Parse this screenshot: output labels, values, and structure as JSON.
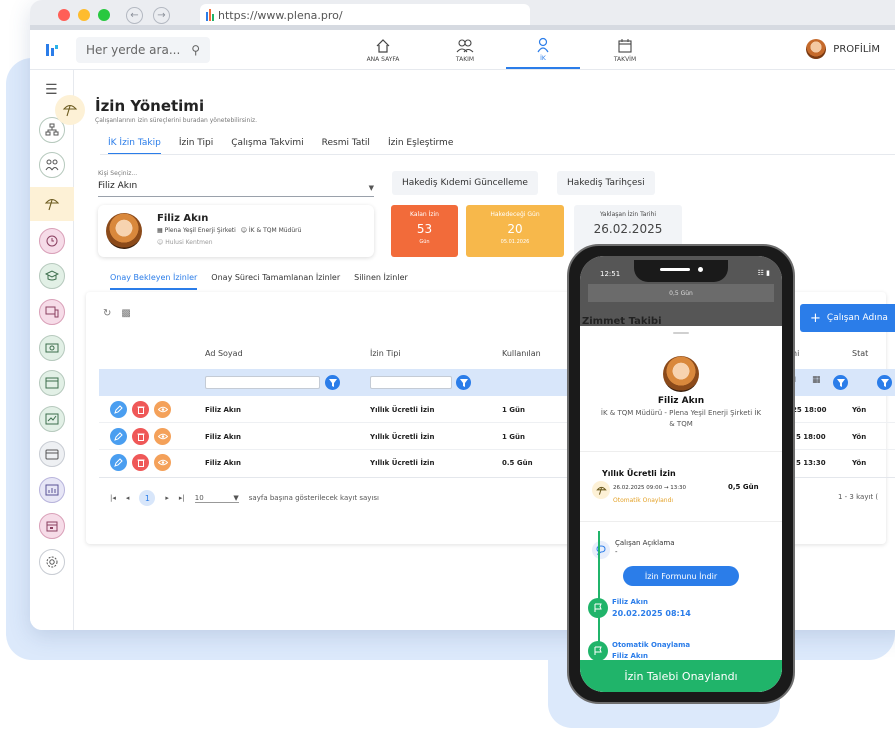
{
  "browser": {
    "url": "https://www.plena.pro/"
  },
  "appnav": {
    "search_placeholder": "Her yerde ara...",
    "items": [
      {
        "label": "ANA SAYFA",
        "icon": "home-icon"
      },
      {
        "label": "TAKIM",
        "icon": "team-icon"
      },
      {
        "label": "İK",
        "icon": "hr-icon",
        "active": true
      },
      {
        "label": "TAKVİM",
        "icon": "calendar-icon"
      }
    ],
    "profile_label": "PROFİLİM"
  },
  "page": {
    "title": "İzin Yönetimi",
    "subtitle": "Çalışanlarının izin süreçlerini buradan yönetebilirsiniz.",
    "tabs": [
      "İK İzin Takip",
      "İzin Tipi",
      "Çalışma Takvimi",
      "Resmi Tatil",
      "İzin Eşleştirme"
    ],
    "active_tab": "İK İzin Takip"
  },
  "person_select": {
    "label": "Kişi Seçiniz...",
    "value": "Filiz Akın"
  },
  "actions": {
    "update_button": "Hakediş Kıdemi Güncelleme",
    "history_button": "Hakediş Tarihçesi"
  },
  "person_card": {
    "name": "Filiz Akın",
    "company_role": "Plena Yeşil Enerji Şirketi",
    "department_role": "İK & TQM Müdürü",
    "manager": "Hulusi Kentmen"
  },
  "stats": [
    {
      "label": "Kalan İzin",
      "value": "53",
      "sub": "Gün",
      "color": "#f26b3a",
      "text": "#ffffff"
    },
    {
      "label": "Hakedeceği Gün",
      "value": "20",
      "sub": "05.01.2026",
      "color": "#f7b84b",
      "text": "#ffffff"
    },
    {
      "label": "Yaklaşan İzin Tarihi",
      "value": "26.02.2025",
      "sub": "",
      "color": "#f2f4f7",
      "text": "#444444"
    }
  ],
  "subtabs": [
    "Onay Bekleyen İzinler",
    "Onay Süreci Tamamlanan İzinler",
    "Silinen İzinler"
  ],
  "table": {
    "headers": [
      "Ad Soyad",
      "İzin Tipi",
      "Kullanılan"
    ],
    "rows": [
      {
        "name": "Filiz Akın",
        "type": "Yıllık Ücretli İzin",
        "used": "1 Gün",
        "date_partial": "25 18:00",
        "status_partial": "Yön"
      },
      {
        "name": "Filiz Akın",
        "type": "Yıllık Ücretli İzin",
        "used": "1 Gün",
        "date_partial": "5 18:00",
        "status_partial": "Yön"
      },
      {
        "name": "Filiz Akın",
        "type": "Yıllık Ücretli İzin",
        "used": "0.5 Gün",
        "date_partial": "5 13:30",
        "status_partial": "Yön"
      }
    ],
    "partial_header_date": "hi",
    "partial_header_status": "Stat",
    "partial_filter": "ıl",
    "pager": {
      "current_page": "1",
      "per_page": "10",
      "per_page_label": "sayfa başına gösterilecek kayıt sayısı",
      "count_text": "1 - 3 kayıt ("
    }
  },
  "add_button": "Çalışan Adına",
  "phone": {
    "time": "12:51",
    "dim_row": "0,5 Gün",
    "dim_title": "Zimmet Takibi",
    "name": "Filiz Akın",
    "role": "İK & TQM Müdürü - Plena Yeşil Enerji Şirketi  İK & TQM",
    "leave_title": "Yıllık Ücretli İzin",
    "leave_date": "26.02.2025 09:00 → 13:30",
    "leave_days": "0,5 Gün",
    "leave_status": "Otomatik Onaylandı",
    "desc_label": "Çalışan Açıklama",
    "desc_value": "-",
    "download_button": "İzin Formunu İndir",
    "timeline": [
      {
        "line1": "Filiz Akın",
        "line2": "20.02.2025 08:14"
      },
      {
        "line1": "Otomatik Onaylama",
        "line2": "Filiz Akın"
      }
    ],
    "bottom_text": "İzin Talebi Onaylandı"
  }
}
